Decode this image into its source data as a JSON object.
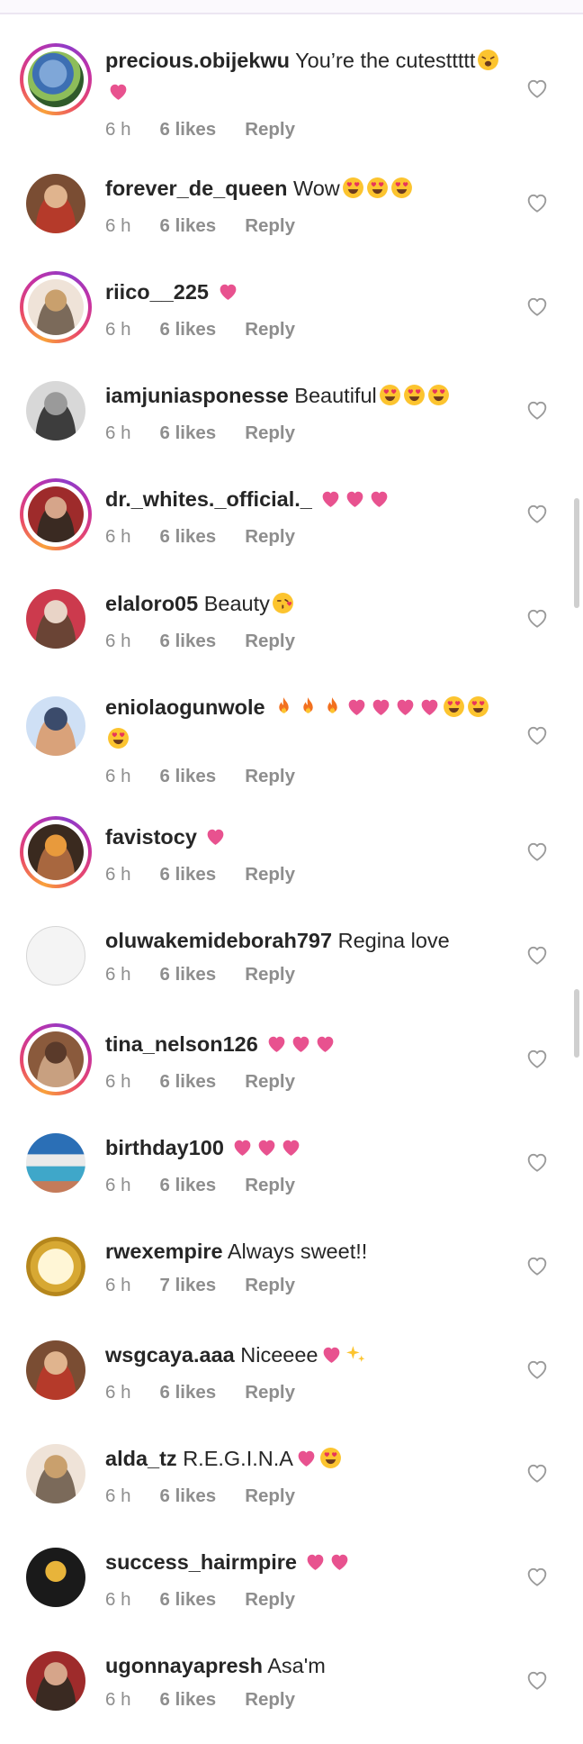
{
  "icons": {
    "like": "heart-outline-icon"
  },
  "comments": [
    {
      "username": "precious.obijekwu",
      "text": "You’re the cutesttttt",
      "emojis": [
        "weary-face",
        "pink-heart"
      ],
      "time": "6 h",
      "likes": "6 likes",
      "reply": "Reply",
      "ring": true,
      "avatar": "cartoon-avatar",
      "two_line": true
    },
    {
      "username": "forever_de_queen",
      "text": "Wow",
      "emojis": [
        "heart-eyes",
        "heart-eyes",
        "heart-eyes"
      ],
      "time": "6 h",
      "likes": "6 likes",
      "reply": "Reply",
      "ring": false,
      "avatar": "person-photo"
    },
    {
      "username": "riico__225",
      "text": "",
      "emojis": [
        "pink-heart"
      ],
      "time": "6 h",
      "likes": "6 likes",
      "reply": "Reply",
      "ring": true,
      "avatar": "person-photo"
    },
    {
      "username": "iamjuniasponesse",
      "text": "Beautiful",
      "emojis": [
        "heart-eyes",
        "heart-eyes",
        "heart-eyes"
      ],
      "time": "6 h",
      "likes": "6 likes",
      "reply": "Reply",
      "ring": false,
      "avatar": "person-photo"
    },
    {
      "username": "dr._whites._official._",
      "text": "",
      "emojis": [
        "pink-heart",
        "pink-heart",
        "pink-heart"
      ],
      "time": "6 h",
      "likes": "6 likes",
      "reply": "Reply",
      "ring": true,
      "avatar": "person-photo"
    },
    {
      "username": "elaloro05",
      "text": "Beauty",
      "emojis": [
        "kissing-heart"
      ],
      "time": "6 h",
      "likes": "6 likes",
      "reply": "Reply",
      "ring": false,
      "avatar": "person-photo"
    },
    {
      "username": "eniolaogunwole",
      "text": "",
      "emojis": [
        "fire",
        "fire",
        "fire",
        "pink-heart",
        "pink-heart",
        "pink-heart",
        "pink-heart",
        "heart-eyes",
        "heart-eyes",
        "heart-eyes"
      ],
      "time": "6 h",
      "likes": "6 likes",
      "reply": "Reply",
      "ring": false,
      "avatar": "person-photo",
      "two_line": true
    },
    {
      "username": "favistocy",
      "text": "",
      "emojis": [
        "pink-heart"
      ],
      "time": "6 h",
      "likes": "6 likes",
      "reply": "Reply",
      "ring": true,
      "avatar": "person-photo"
    },
    {
      "username": "oluwakemideborah797",
      "text": "Regina love",
      "emojis": [],
      "time": "6 h",
      "likes": "6 likes",
      "reply": "Reply",
      "ring": false,
      "avatar": "blank"
    },
    {
      "username": "tina_nelson126",
      "text": "",
      "emojis": [
        "pink-heart",
        "pink-heart",
        "pink-heart"
      ],
      "time": "6 h",
      "likes": "6 likes",
      "reply": "Reply",
      "ring": true,
      "avatar": "person-photo"
    },
    {
      "username": "birthday100",
      "text": "",
      "emojis": [
        "pink-heart",
        "pink-heart",
        "pink-heart"
      ],
      "time": "6 h",
      "likes": "6 likes",
      "reply": "Reply",
      "ring": false,
      "avatar": "pool-photo"
    },
    {
      "username": "rwexempire",
      "text": "Always sweet!!",
      "emojis": [],
      "time": "6 h",
      "likes": "7 likes",
      "reply": "Reply",
      "ring": false,
      "avatar": "gold-r-logo"
    },
    {
      "username": "wsgcaya.aaa",
      "text": "Niceeee",
      "emojis": [
        "pink-heart",
        "sparkles"
      ],
      "time": "6 h",
      "likes": "6 likes",
      "reply": "Reply",
      "ring": false,
      "avatar": "person-photo"
    },
    {
      "username": "alda_tz",
      "text": "R.E.G.I.N.A",
      "emojis": [
        "pink-heart",
        "heart-eyes"
      ],
      "time": "6 h",
      "likes": "6 likes",
      "reply": "Reply",
      "ring": false,
      "avatar": "person-photo"
    },
    {
      "username": "success_hairmpire",
      "text": "",
      "emojis": [
        "pink-heart",
        "pink-heart"
      ],
      "time": "6 h",
      "likes": "6 likes",
      "reply": "Reply",
      "ring": false,
      "avatar": "sale-logo"
    },
    {
      "username": "ugonnayapresh",
      "text": "Asa'm",
      "emojis": [],
      "time": "6 h",
      "likes": "6 likes",
      "reply": "Reply",
      "ring": false,
      "avatar": "person-photo"
    }
  ]
}
